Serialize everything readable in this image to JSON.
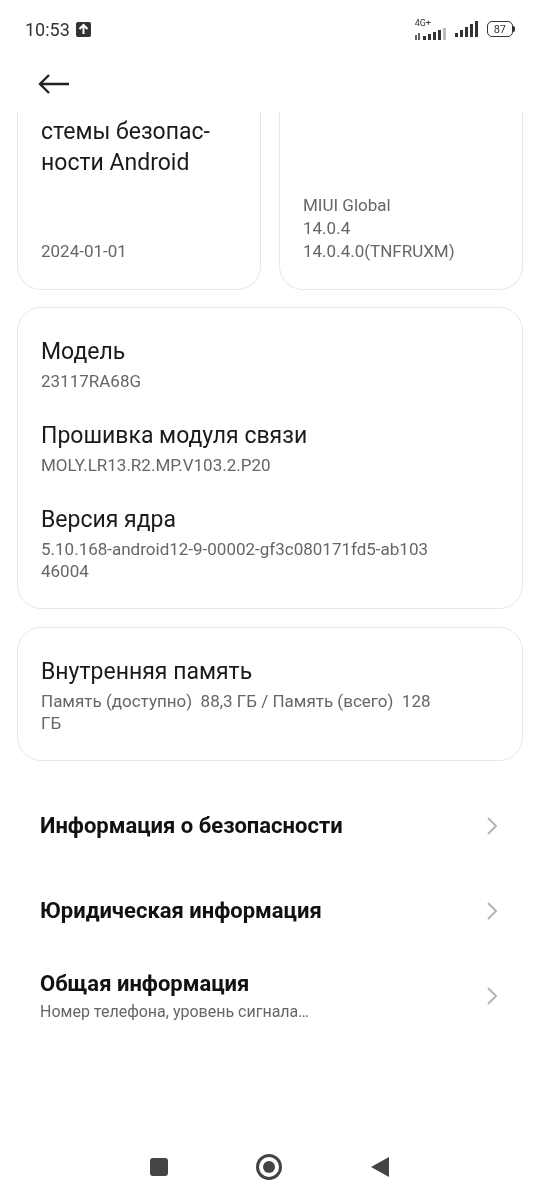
{
  "status_bar": {
    "time": "10:53",
    "network": "4G+",
    "battery": "87"
  },
  "top_cards": [
    {
      "title": "стемы безопас-\nности Android",
      "value": "2024-01-01"
    },
    {
      "value": "MIUI Global\n14.0.4\n14.0.4.0(TNFRUXM)"
    }
  ],
  "device_card": [
    {
      "label": "Модель",
      "value": "23117RA68G"
    },
    {
      "label": "Прошивка модуля связи",
      "value": "MOLY.LR13.R2.MP.V103.2.P20"
    },
    {
      "label": "Версия ядра",
      "value": "5.10.168-android12-9-00002-gf3c080171fd5-ab103\n46004"
    }
  ],
  "storage_card": {
    "label": "Внутренняя память",
    "value": "Память (доступно)  88,3 ГБ / Память (всего)  128\nГБ"
  },
  "menu": [
    {
      "label": "Информация о безопасности"
    },
    {
      "label": "Юридическая информация"
    },
    {
      "label": "Общая информация",
      "subtitle": "Номер телефона, уровень сигнала…"
    }
  ]
}
